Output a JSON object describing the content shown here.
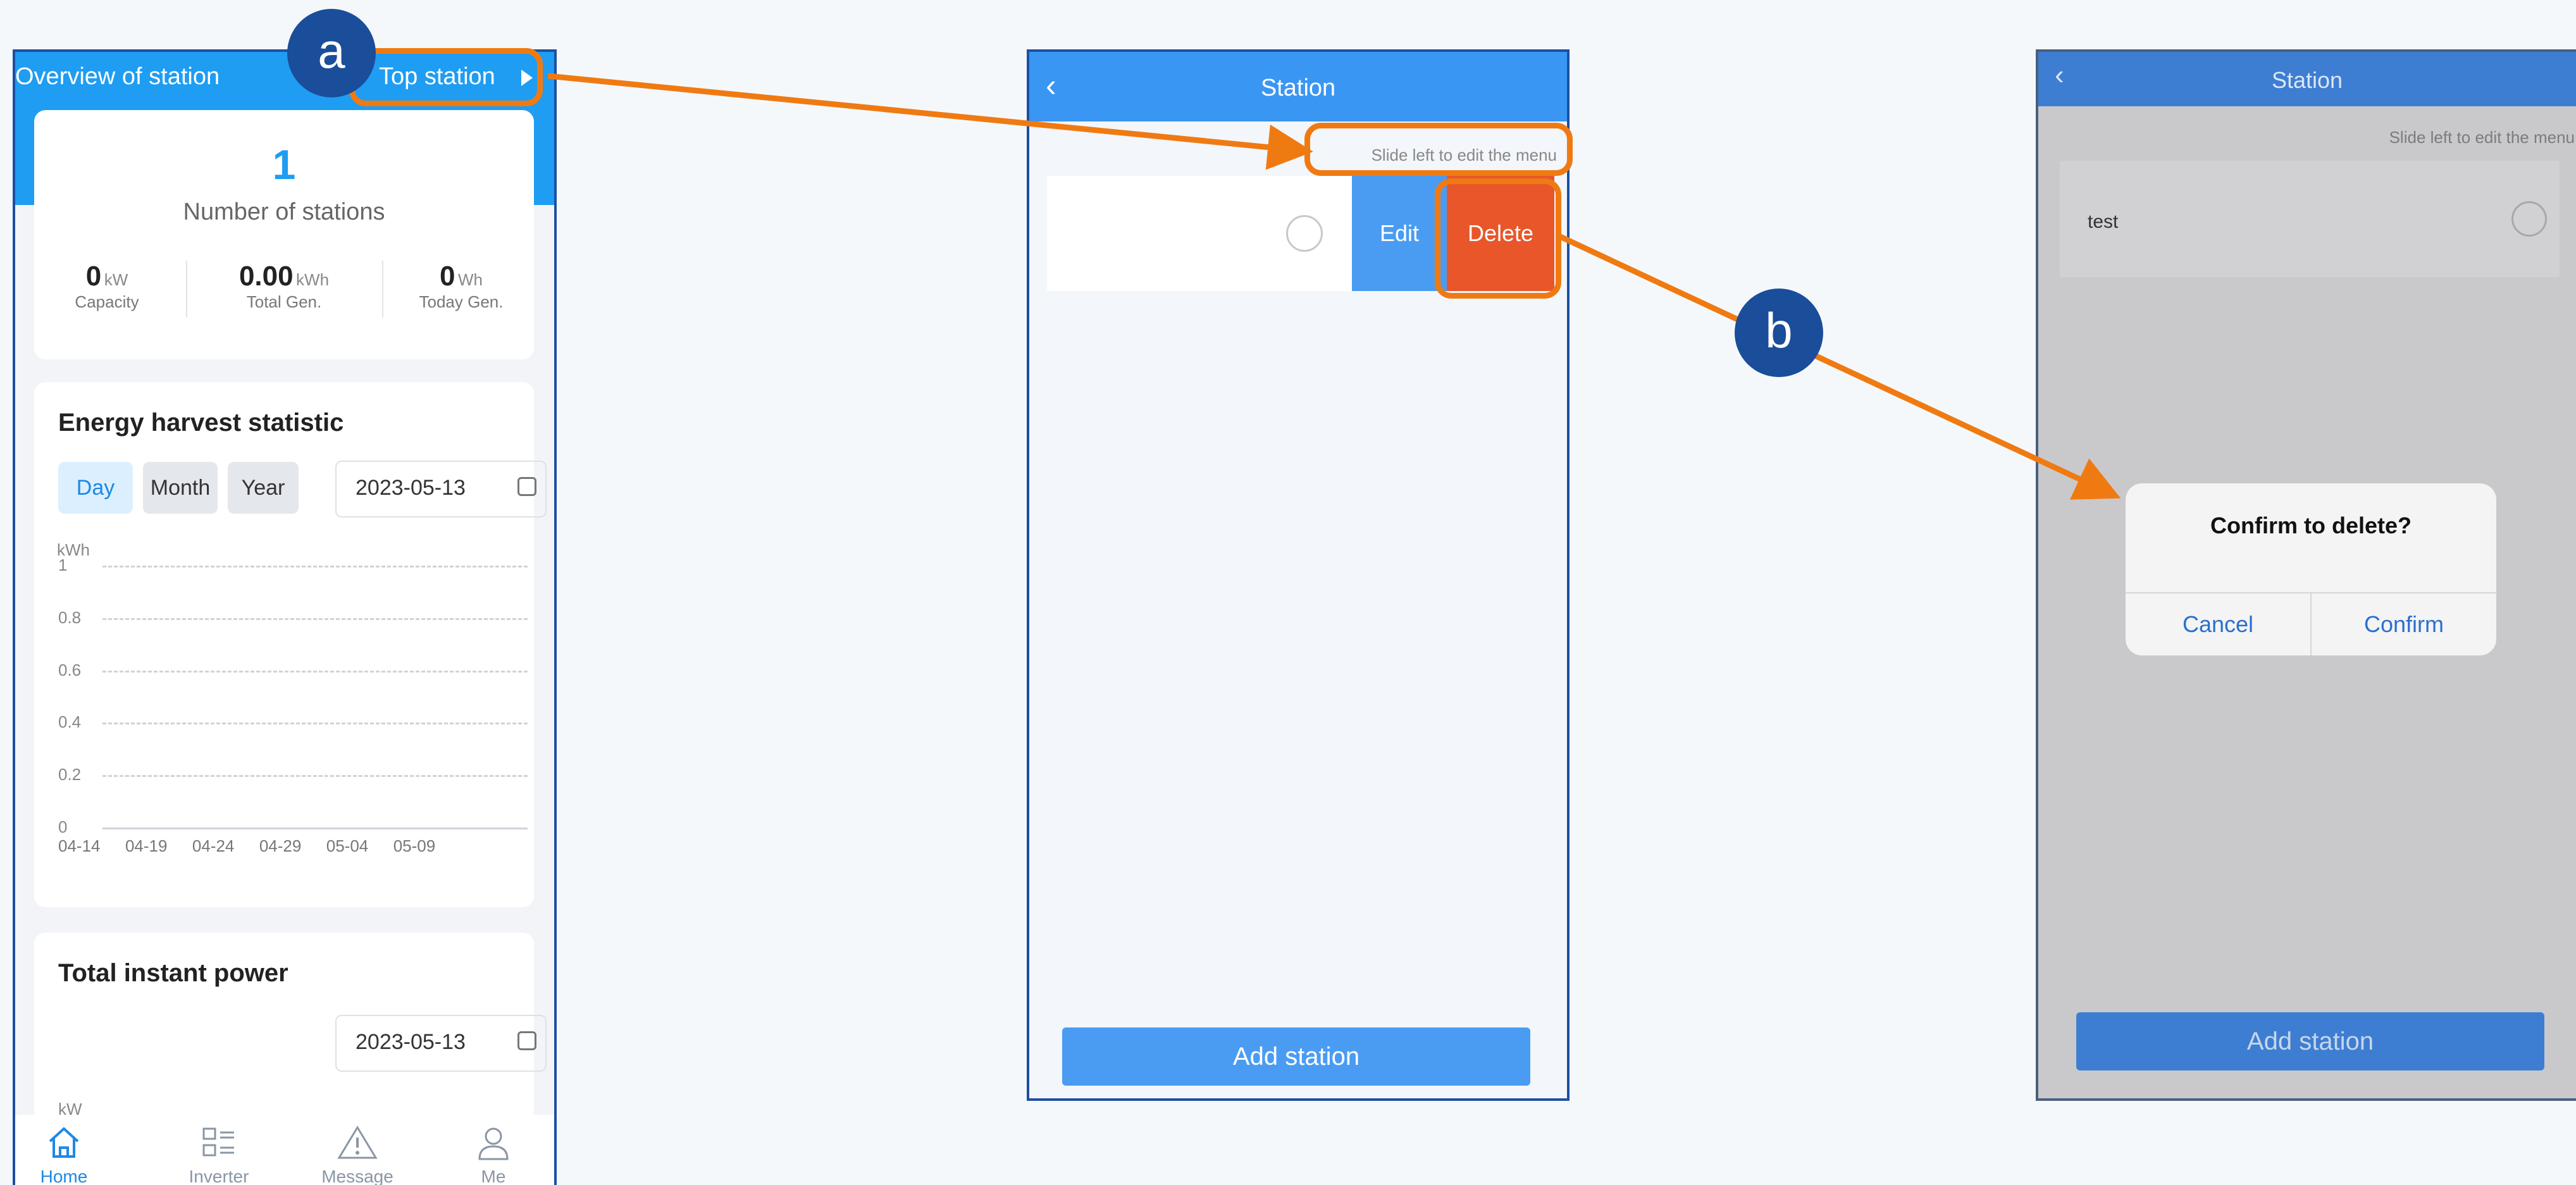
{
  "markers": {
    "a": "a",
    "b": "b"
  },
  "colors": {
    "accent": "#1e9df2",
    "highlight": "#f07a12",
    "delete": "#e8562a",
    "marker": "#1a4d9a"
  },
  "screen1": {
    "header": {
      "title": "Overview of station",
      "top_station": "Top station"
    },
    "count": {
      "value": "1",
      "label": "Number of stations"
    },
    "stats": [
      {
        "value": "0",
        "unit": "kW",
        "label": "Capacity"
      },
      {
        "value": "0.00",
        "unit": "kWh",
        "label": "Total Gen."
      },
      {
        "value": "0",
        "unit": "Wh",
        "label": "Today Gen."
      }
    ],
    "energy": {
      "title": "Energy harvest statistic",
      "tabs": [
        "Day",
        "Month",
        "Year"
      ],
      "date": "2023-05-13"
    },
    "chart_data": {
      "type": "line",
      "ylabel": "kWh",
      "yticks": [
        "1",
        "0.8",
        "0.6",
        "0.4",
        "0.2",
        "0"
      ],
      "ylim": [
        0,
        1
      ],
      "categories": [
        "04-14",
        "04-19",
        "04-24",
        "04-29",
        "05-04",
        "05-09"
      ],
      "values": [
        0,
        0,
        0,
        0,
        0,
        0
      ],
      "grid": true
    },
    "power": {
      "title": "Total instant power",
      "date": "2023-05-13",
      "unit": "kW"
    },
    "tabbar": [
      "Home",
      "Inverter",
      "Message",
      "Me"
    ]
  },
  "screen2": {
    "title": "Station",
    "back": "‹",
    "hint": "Slide left to edit the menu",
    "edit": "Edit",
    "delete": "Delete",
    "add": "Add station"
  },
  "screen3": {
    "title": "Station",
    "back": "‹",
    "hint": "Slide left to edit the menu",
    "item": "test",
    "dialog": {
      "title": "Confirm to delete?",
      "cancel": "Cancel",
      "confirm": "Confirm"
    },
    "add": "Add station"
  }
}
